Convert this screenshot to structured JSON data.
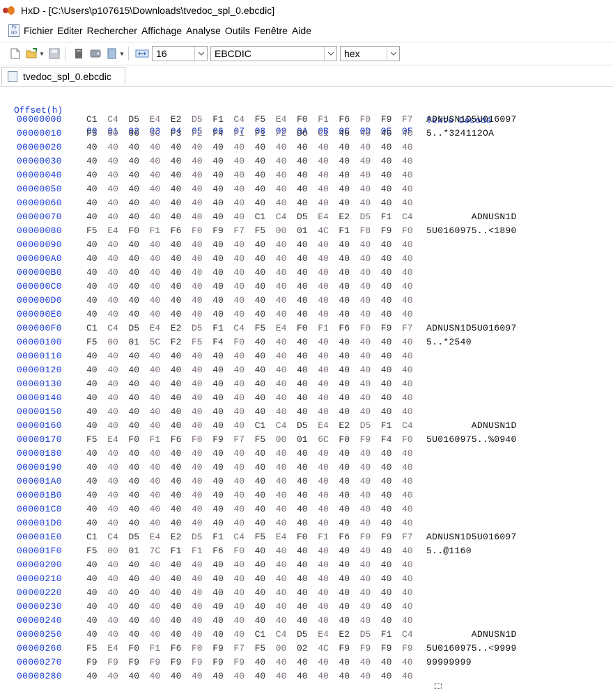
{
  "window": {
    "title": "HxD - [C:\\Users\\p107615\\Downloads\\tvedoc_spl_0.ebcdic]"
  },
  "menu": [
    "Fichier",
    "Editer",
    "Rechercher",
    "Affichage",
    "Analyse",
    "Outils",
    "Fenêtre",
    "Aide"
  ],
  "toolbar": {
    "bytes_per_row": "16",
    "charset": "EBCDIC",
    "offset_base": "hex",
    "icons": [
      "new-file-icon",
      "open-file-icon",
      "save-icon",
      "dropdown-icon",
      "close-file-icon",
      "disk-icon",
      "doc-icon",
      "columns-icon"
    ]
  },
  "tab": {
    "label": "tvedoc_spl_0.ebcdic"
  },
  "editor": {
    "header": {
      "offset_label": "Offset(h)",
      "columns": [
        "00",
        "01",
        "02",
        "03",
        "04",
        "05",
        "06",
        "07",
        "08",
        "09",
        "0A",
        "0B",
        "0C",
        "0D",
        "0E",
        "0F"
      ],
      "text_label": "Texte Décodé"
    },
    "rows": [
      {
        "offset": "00000000",
        "bytes": "C1 C4 D5 E4 E2 D5 F1 C4 F5 E4 F0 F1 F6 F0 F9 F7",
        "text": "ADNUSN1D5U016097"
      },
      {
        "offset": "00000010",
        "bytes": "F5 00 00 5C F3 F2 F4 F1 F1 F2 D6 C1 40 40 40 40",
        "text": "5..*324112OA"
      },
      {
        "offset": "00000020",
        "bytes": "40 40 40 40 40 40 40 40 40 40 40 40 40 40 40 40",
        "text": ""
      },
      {
        "offset": "00000030",
        "bytes": "40 40 40 40 40 40 40 40 40 40 40 40 40 40 40 40",
        "text": ""
      },
      {
        "offset": "00000040",
        "bytes": "40 40 40 40 40 40 40 40 40 40 40 40 40 40 40 40",
        "text": ""
      },
      {
        "offset": "00000050",
        "bytes": "40 40 40 40 40 40 40 40 40 40 40 40 40 40 40 40",
        "text": ""
      },
      {
        "offset": "00000060",
        "bytes": "40 40 40 40 40 40 40 40 40 40 40 40 40 40 40 40",
        "text": ""
      },
      {
        "offset": "00000070",
        "bytes": "40 40 40 40 40 40 40 40 C1 C4 D5 E4 E2 D5 F1 C4",
        "text": "        ADNUSN1D"
      },
      {
        "offset": "00000080",
        "bytes": "F5 E4 F0 F1 F6 F0 F9 F7 F5 00 01 4C F1 F8 F9 F0",
        "text": "5U0160975..<1890"
      },
      {
        "offset": "00000090",
        "bytes": "40 40 40 40 40 40 40 40 40 40 40 40 40 40 40 40",
        "text": ""
      },
      {
        "offset": "000000A0",
        "bytes": "40 40 40 40 40 40 40 40 40 40 40 40 40 40 40 40",
        "text": ""
      },
      {
        "offset": "000000B0",
        "bytes": "40 40 40 40 40 40 40 40 40 40 40 40 40 40 40 40",
        "text": ""
      },
      {
        "offset": "000000C0",
        "bytes": "40 40 40 40 40 40 40 40 40 40 40 40 40 40 40 40",
        "text": ""
      },
      {
        "offset": "000000D0",
        "bytes": "40 40 40 40 40 40 40 40 40 40 40 40 40 40 40 40",
        "text": ""
      },
      {
        "offset": "000000E0",
        "bytes": "40 40 40 40 40 40 40 40 40 40 40 40 40 40 40 40",
        "text": ""
      },
      {
        "offset": "000000F0",
        "bytes": "C1 C4 D5 E4 E2 D5 F1 C4 F5 E4 F0 F1 F6 F0 F9 F7",
        "text": "ADNUSN1D5U016097"
      },
      {
        "offset": "00000100",
        "bytes": "F5 00 01 5C F2 F5 F4 F0 40 40 40 40 40 40 40 40",
        "text": "5..*2540"
      },
      {
        "offset": "00000110",
        "bytes": "40 40 40 40 40 40 40 40 40 40 40 40 40 40 40 40",
        "text": ""
      },
      {
        "offset": "00000120",
        "bytes": "40 40 40 40 40 40 40 40 40 40 40 40 40 40 40 40",
        "text": ""
      },
      {
        "offset": "00000130",
        "bytes": "40 40 40 40 40 40 40 40 40 40 40 40 40 40 40 40",
        "text": ""
      },
      {
        "offset": "00000140",
        "bytes": "40 40 40 40 40 40 40 40 40 40 40 40 40 40 40 40",
        "text": ""
      },
      {
        "offset": "00000150",
        "bytes": "40 40 40 40 40 40 40 40 40 40 40 40 40 40 40 40",
        "text": ""
      },
      {
        "offset": "00000160",
        "bytes": "40 40 40 40 40 40 40 40 C1 C4 D5 E4 E2 D5 F1 C4",
        "text": "        ADNUSN1D"
      },
      {
        "offset": "00000170",
        "bytes": "F5 E4 F0 F1 F6 F0 F9 F7 F5 00 01 6C F0 F9 F4 F0",
        "text": "5U0160975..%0940"
      },
      {
        "offset": "00000180",
        "bytes": "40 40 40 40 40 40 40 40 40 40 40 40 40 40 40 40",
        "text": ""
      },
      {
        "offset": "00000190",
        "bytes": "40 40 40 40 40 40 40 40 40 40 40 40 40 40 40 40",
        "text": ""
      },
      {
        "offset": "000001A0",
        "bytes": "40 40 40 40 40 40 40 40 40 40 40 40 40 40 40 40",
        "text": ""
      },
      {
        "offset": "000001B0",
        "bytes": "40 40 40 40 40 40 40 40 40 40 40 40 40 40 40 40",
        "text": ""
      },
      {
        "offset": "000001C0",
        "bytes": "40 40 40 40 40 40 40 40 40 40 40 40 40 40 40 40",
        "text": ""
      },
      {
        "offset": "000001D0",
        "bytes": "40 40 40 40 40 40 40 40 40 40 40 40 40 40 40 40",
        "text": ""
      },
      {
        "offset": "000001E0",
        "bytes": "C1 C4 D5 E4 E2 D5 F1 C4 F5 E4 F0 F1 F6 F0 F9 F7",
        "text": "ADNUSN1D5U016097"
      },
      {
        "offset": "000001F0",
        "bytes": "F5 00 01 7C F1 F1 F6 F0 40 40 40 40 40 40 40 40",
        "text": "5..@1160"
      },
      {
        "offset": "00000200",
        "bytes": "40 40 40 40 40 40 40 40 40 40 40 40 40 40 40 40",
        "text": ""
      },
      {
        "offset": "00000210",
        "bytes": "40 40 40 40 40 40 40 40 40 40 40 40 40 40 40 40",
        "text": ""
      },
      {
        "offset": "00000220",
        "bytes": "40 40 40 40 40 40 40 40 40 40 40 40 40 40 40 40",
        "text": ""
      },
      {
        "offset": "00000230",
        "bytes": "40 40 40 40 40 40 40 40 40 40 40 40 40 40 40 40",
        "text": ""
      },
      {
        "offset": "00000240",
        "bytes": "40 40 40 40 40 40 40 40 40 40 40 40 40 40 40 40",
        "text": ""
      },
      {
        "offset": "00000250",
        "bytes": "40 40 40 40 40 40 40 40 C1 C4 D5 E4 E2 D5 F1 C4",
        "text": "        ADNUSN1D"
      },
      {
        "offset": "00000260",
        "bytes": "F5 E4 F0 F1 F6 F0 F9 F7 F5 00 02 4C F9 F9 F9 F9",
        "text": "5U0160975..<9999"
      },
      {
        "offset": "00000270",
        "bytes": "F9 F9 F9 F9 F9 F9 F9 F9 40 40 40 40 40 40 40 40",
        "text": "99999999"
      },
      {
        "offset": "00000280",
        "bytes": "40 40 40 40 40 40 40 40 40 40 40 40 40 40 40 40",
        "text": ""
      }
    ]
  },
  "colors": {
    "offset_blue": "#1a3cd6",
    "hex_text": "#333333",
    "dim_hex": "#7a6a7a"
  }
}
